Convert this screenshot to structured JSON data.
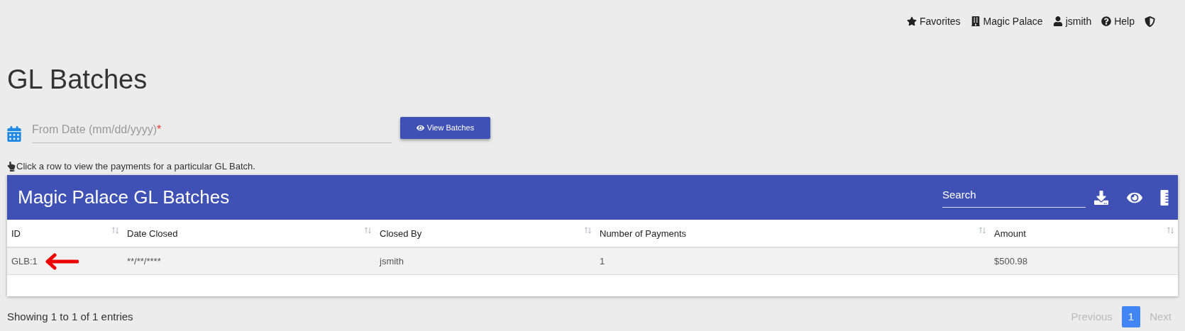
{
  "top_nav": [
    {
      "kind": "favorites",
      "label": "Favorites"
    },
    {
      "kind": "property",
      "label": "Magic Palace"
    },
    {
      "kind": "user",
      "label": "jsmith"
    },
    {
      "kind": "help",
      "label": "Help"
    },
    {
      "kind": "shield"
    }
  ],
  "page_title": "GL Batches",
  "from_date": {
    "placeholder": "From Date (mm/dd/yyyy)",
    "required_mark": "*"
  },
  "view_button": "View Batches",
  "hint": "Click a row to view the payments for a particular GL Batch.",
  "table": {
    "title": "Magic Palace GL Batches",
    "search": {
      "placeholder": "Search"
    },
    "columns": [
      "ID",
      "Date Closed",
      "Closed By",
      "Number of Payments",
      "Amount"
    ],
    "rows": [
      {
        "cells": [
          "GLB:1",
          "**/**/****",
          "jsmith",
          "1",
          "$500.98"
        ],
        "annotated": true
      }
    ]
  },
  "footer": {
    "info": "Showing 1 to 1 of 1 entries",
    "pagination": [
      {
        "label": "Previous",
        "selected": false,
        "disabled": true
      },
      {
        "label": "1",
        "selected": true,
        "disabled": false
      },
      {
        "label": "Next",
        "selected": false,
        "disabled": true
      }
    ]
  }
}
